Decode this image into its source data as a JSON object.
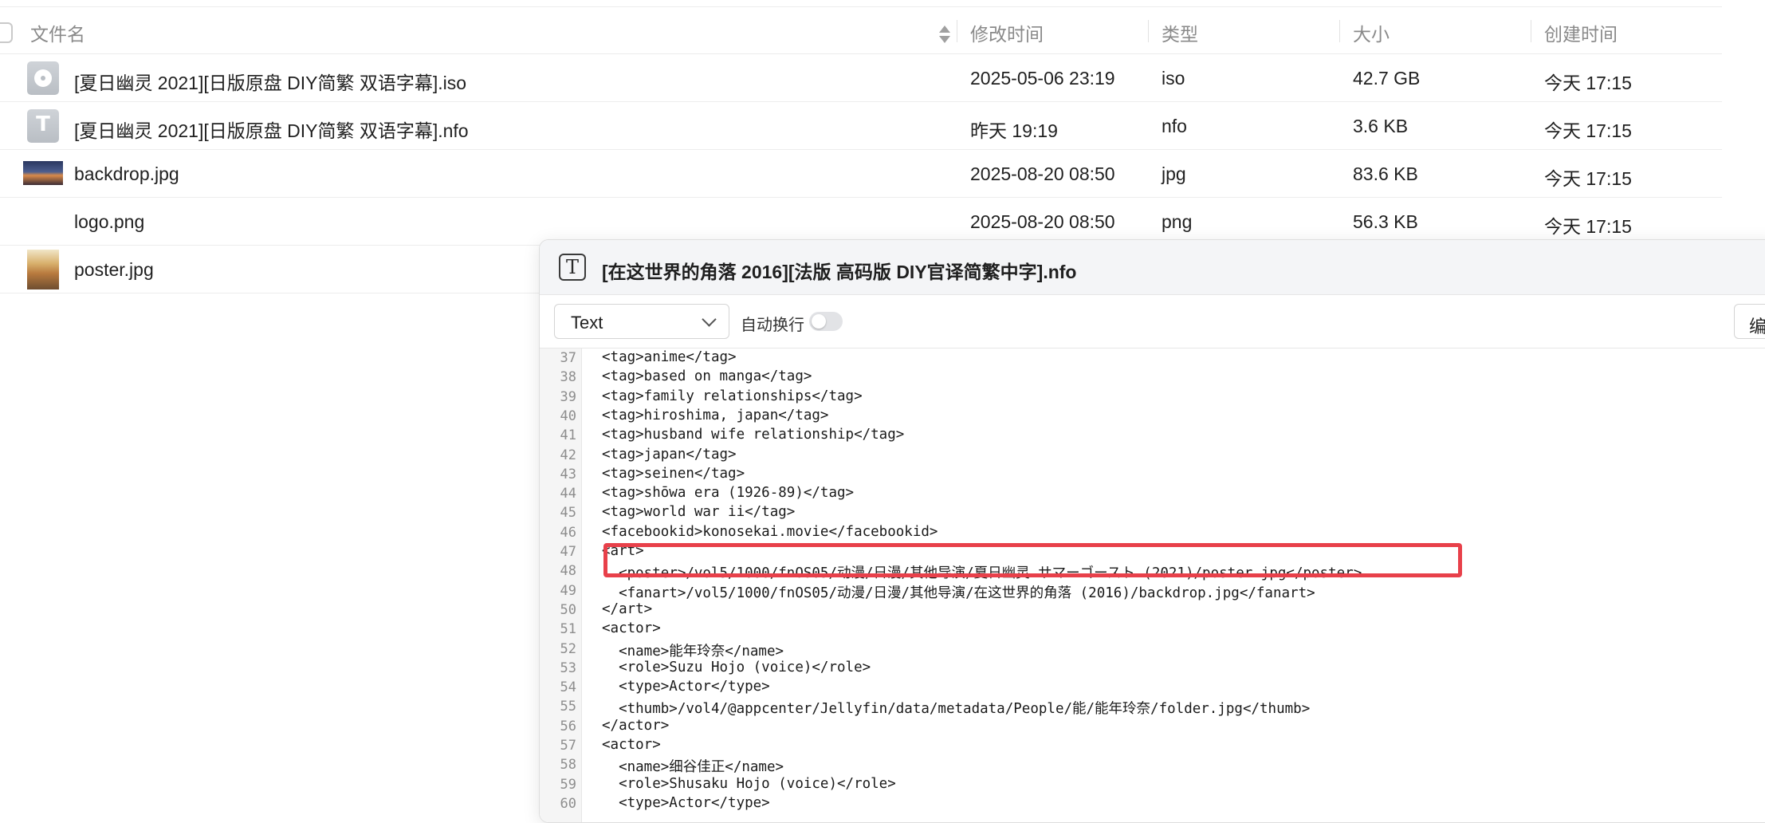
{
  "file_list": {
    "columns": {
      "name": "文件名",
      "modified": "修改时间",
      "type": "类型",
      "size": "大小",
      "created": "创建时间"
    },
    "rows": [
      {
        "name": "[夏日幽灵 2021][日版原盘 DIY简繁 双语字幕].iso",
        "modified": "2025-05-06 23:19",
        "type": "iso",
        "size": "42.7 GB",
        "created": "今天 17:15",
        "icon": "disc-image-icon"
      },
      {
        "name": "[夏日幽灵 2021][日版原盘 DIY简繁 双语字幕].nfo",
        "modified": "昨天 19:19",
        "type": "nfo",
        "size": "3.6 KB",
        "created": "今天 17:15",
        "icon": "text-file-icon"
      },
      {
        "name": "backdrop.jpg",
        "modified": "2025-08-20 08:50",
        "type": "jpg",
        "size": "83.6 KB",
        "created": "今天 17:15",
        "icon": "image-thumbnail"
      },
      {
        "name": "logo.png",
        "modified": "2025-08-20 08:50",
        "type": "png",
        "size": "56.3 KB",
        "created": "今天 17:15",
        "icon": "none"
      },
      {
        "name": "poster.jpg",
        "modified": "",
        "type": "",
        "size": "",
        "created": "",
        "icon": "image-thumbnail"
      }
    ]
  },
  "dialog": {
    "title": "[在这世界的角落 2016][法版 高码版 DIY官译简繁中字].nfo",
    "title_icon": "text-file-icon",
    "mode_select": "Text",
    "wrap_label": "自动换行",
    "wrap_enabled": false,
    "edit_button": "编",
    "highlight_color": "#e8404a",
    "lines": [
      {
        "n": "37",
        "text": "<tag>anime</tag>"
      },
      {
        "n": "38",
        "text": "<tag>based on manga</tag>"
      },
      {
        "n": "39",
        "text": "<tag>family relationships</tag>"
      },
      {
        "n": "40",
        "text": "<tag>hiroshima, japan</tag>"
      },
      {
        "n": "41",
        "text": "<tag>husband wife relationship</tag>"
      },
      {
        "n": "42",
        "text": "<tag>japan</tag>"
      },
      {
        "n": "43",
        "text": "<tag>seinen</tag>"
      },
      {
        "n": "44",
        "text": "<tag>shōwa era (1926-89)</tag>"
      },
      {
        "n": "45",
        "text": "<tag>world war ii</tag>"
      },
      {
        "n": "46",
        "text": "<facebookid>konosekai.movie</facebookid>"
      },
      {
        "n": "47",
        "text": "<art>"
      },
      {
        "n": "48",
        "text": "  <poster>/vol5/1000/fnOS05/动漫/日漫/其他导演/夏日幽灵 サマーゴースト (2021)/poster.jpg</poster>"
      },
      {
        "n": "49",
        "text": "  <fanart>/vol5/1000/fnOS05/动漫/日漫/其他导演/在这世界的角落 (2016)/backdrop.jpg</fanart>"
      },
      {
        "n": "50",
        "text": "</art>"
      },
      {
        "n": "51",
        "text": "<actor>"
      },
      {
        "n": "52",
        "text": "  <name>能年玲奈</name>"
      },
      {
        "n": "53",
        "text": "  <role>Suzu Hojo (voice)</role>"
      },
      {
        "n": "54",
        "text": "  <type>Actor</type>"
      },
      {
        "n": "55",
        "text": "  <thumb>/vol4/@appcenter/Jellyfin/data/metadata/People/能/能年玲奈/folder.jpg</thumb>"
      },
      {
        "n": "56",
        "text": "</actor>"
      },
      {
        "n": "57",
        "text": "<actor>"
      },
      {
        "n": "58",
        "text": "  <name>细谷佳正</name>"
      },
      {
        "n": "59",
        "text": "  <role>Shusaku Hojo (voice)</role>"
      },
      {
        "n": "60",
        "text": "  <type>Actor</type>"
      }
    ]
  }
}
